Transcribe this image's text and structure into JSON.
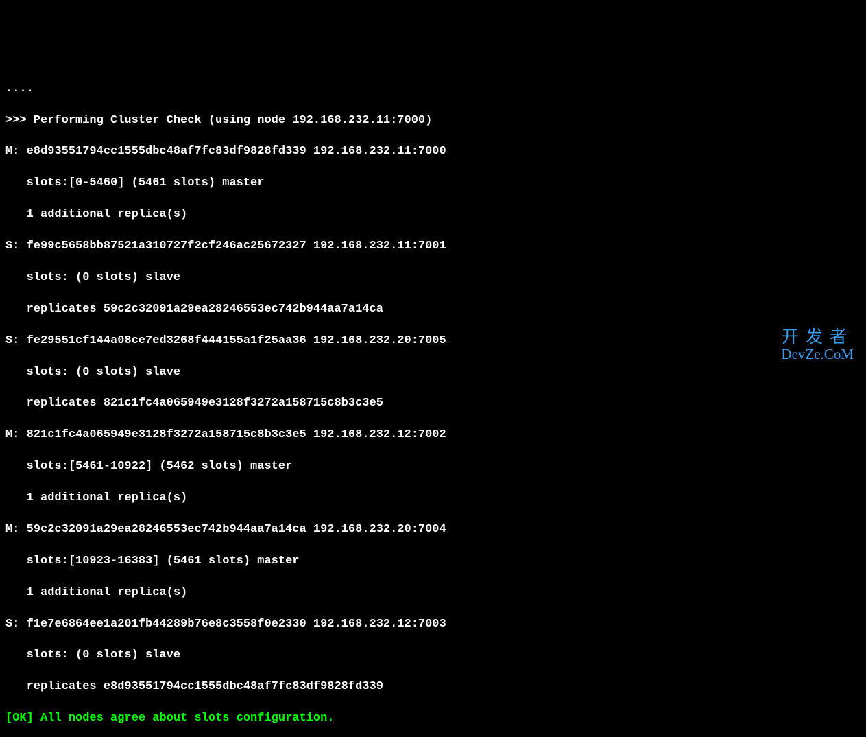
{
  "lines": {
    "l0": "....",
    "l1": ">>> Performing Cluster Check (using node 192.168.232.11:7000)",
    "l2": "M: e8d93551794cc1555dbc48af7fc83df9828fd339 192.168.232.11:7000",
    "l3": "   slots:[0-5460] (5461 slots) master",
    "l4": "   1 additional replica(s)",
    "l5": "S: fe99c5658bb87521a310727f2cf246ac25672327 192.168.232.11:7001",
    "l6": "   slots: (0 slots) slave",
    "l7": "   replicates 59c2c32091a29ea28246553ec742b944aa7a14ca",
    "l8": "S: fe29551cf144a08ce7ed3268f444155a1f25aa36 192.168.232.20:7005",
    "l9": "   slots: (0 slots) slave",
    "l10": "   replicates 821c1fc4a065949e3128f3272a158715c8b3c3e5",
    "l11": "M: 821c1fc4a065949e3128f3272a158715c8b3c3e5 192.168.232.12:7002",
    "l12": "   slots:[5461-10922] (5462 slots) master",
    "l13": "   1 additional replica(s)",
    "l14": "M: 59c2c32091a29ea28246553ec742b944aa7a14ca 192.168.232.20:7004",
    "l15": "   slots:[10923-16383] (5461 slots) master",
    "l16": "   1 additional replica(s)",
    "l17": "S: f1e7e6864ee1a201fb44289b76e8c3558f0e2330 192.168.232.12:7003",
    "l18": "   slots: (0 slots) slave",
    "l19": "   replicates e8d93551794cc1555dbc48af7fc83df9828fd339",
    "l20": "[OK] All nodes agree about slots configuration."
  },
  "watermark": {
    "cn": "开发者",
    "en": "DevZe.CoM"
  }
}
